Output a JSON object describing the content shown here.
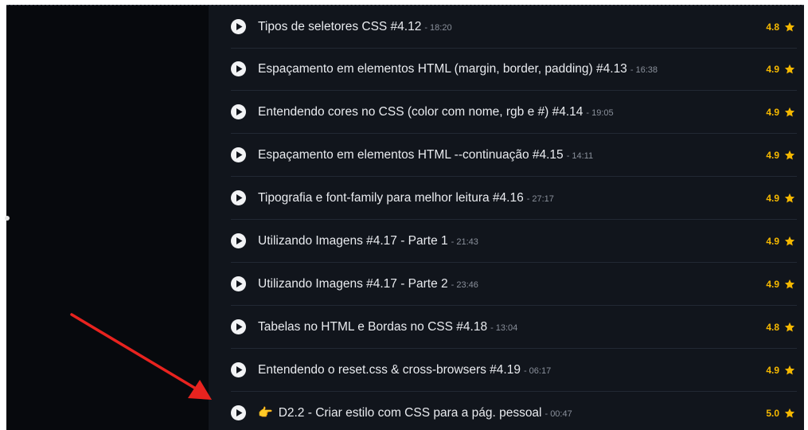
{
  "lessons": [
    {
      "title": "Tipos de seletores CSS #4.12",
      "duration": "18:20",
      "rating": "4.8"
    },
    {
      "title": "Espaçamento em elementos HTML (margin, border, padding) #4.13",
      "duration": "16:38",
      "rating": "4.9"
    },
    {
      "title": "Entendendo cores no CSS (color com nome, rgb e #) #4.14",
      "duration": "19:05",
      "rating": "4.9"
    },
    {
      "title": "Espaçamento em elementos HTML --continuação #4.15",
      "duration": "14:11",
      "rating": "4.9"
    },
    {
      "title": "Tipografia e font-family para melhor leitura #4.16",
      "duration": "27:17",
      "rating": "4.9"
    },
    {
      "title": "Utilizando Imagens #4.17 - Parte 1",
      "duration": "21:43",
      "rating": "4.9"
    },
    {
      "title": "Utilizando Imagens #4.17 - Parte 2",
      "duration": "23:46",
      "rating": "4.9"
    },
    {
      "title": "Tabelas no HTML e Bordas no CSS #4.18",
      "duration": "13:04",
      "rating": "4.8"
    },
    {
      "title": "Entendendo o reset.css & cross-browsers #4.19",
      "duration": "06:17",
      "rating": "4.9"
    },
    {
      "title": "D2.2 - Criar estilo com CSS para a pág. pessoal",
      "duration": "00:47",
      "rating": "5.0",
      "emoji": "👉"
    }
  ],
  "separator": "-",
  "colors": {
    "background": "#0b0e14",
    "list_background": "#11151c",
    "text": "#e9ebef",
    "muted": "#8a909b",
    "rating": "#f5b800",
    "arrow": "#e8231f"
  },
  "icons": {
    "play": "play-circle-icon",
    "star": "star-icon",
    "pointing_hand": "pointing-hand-icon",
    "annotation": "red-arrow-annotation"
  }
}
